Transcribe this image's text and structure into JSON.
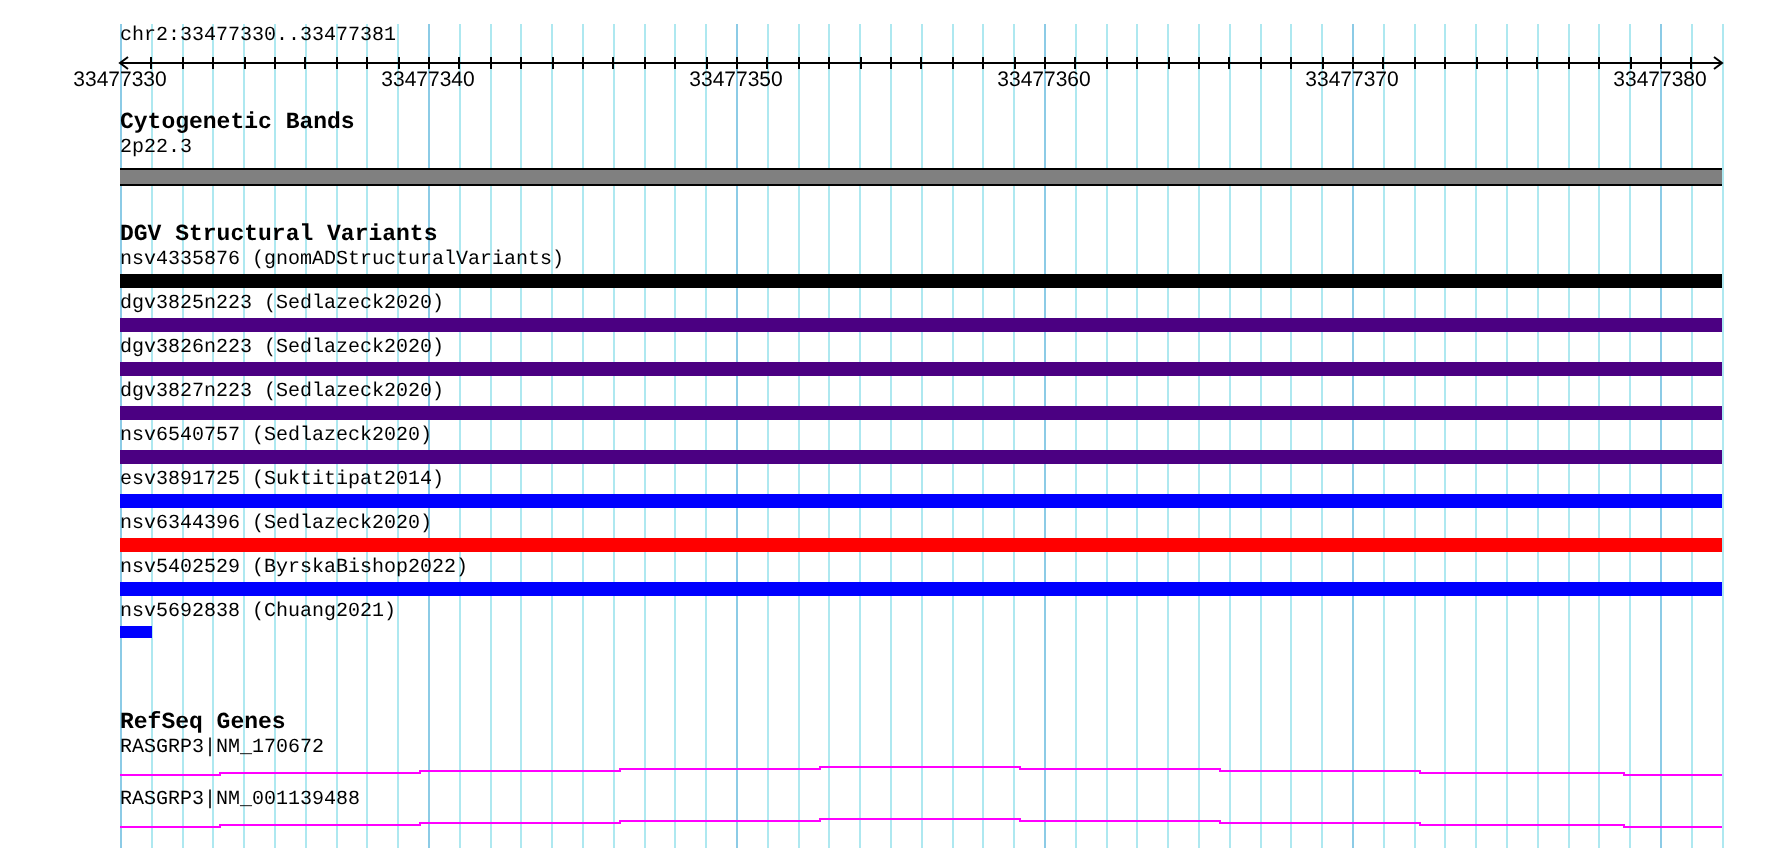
{
  "location": "chr2:33477330..33477381",
  "ruler": {
    "ticks": [
      "33477330",
      "33477340",
      "33477350",
      "33477360",
      "33477370",
      "33477380"
    ]
  },
  "tracks": [
    {
      "title": "Cytogenetic Bands",
      "kind": "band",
      "features": [
        {
          "label": "2p22.3",
          "color": "#808080",
          "kind": "full"
        }
      ]
    },
    {
      "title": "DGV Structural Variants",
      "kind": "variant",
      "features": [
        {
          "label": "nsv4335876 (gnomADStructuralVariants)",
          "color": "#000000",
          "kind": "full"
        },
        {
          "label": "dgv3825n223 (Sedlazeck2020)",
          "color": "#4b0082",
          "kind": "full"
        },
        {
          "label": "dgv3826n223 (Sedlazeck2020)",
          "color": "#4b0082",
          "kind": "full"
        },
        {
          "label": "dgv3827n223 (Sedlazeck2020)",
          "color": "#4b0082",
          "kind": "full"
        },
        {
          "label": "nsv6540757 (Sedlazeck2020)",
          "color": "#4b0082",
          "kind": "full"
        },
        {
          "label": "esv3891725 (Suktitipat2014)",
          "color": "#0000ff",
          "kind": "full"
        },
        {
          "label": "nsv6344396 (Sedlazeck2020)",
          "color": "#ff0000",
          "kind": "full"
        },
        {
          "label": "nsv5402529 (ByrskaBishop2022)",
          "color": "#0000ff",
          "kind": "full"
        },
        {
          "label": "nsv5692838 (Chuang2021)",
          "color": "#0000ff",
          "kind": "partial"
        }
      ]
    },
    {
      "title": "RefSeq Genes",
      "kind": "gene",
      "features": [
        {
          "label": "RASGRP3|NM_170672",
          "color": "#ff00ff",
          "kind": "full"
        },
        {
          "label": "RASGRP3|NM_001139488",
          "color": "#ff00ff",
          "kind": "full"
        }
      ]
    }
  ]
}
